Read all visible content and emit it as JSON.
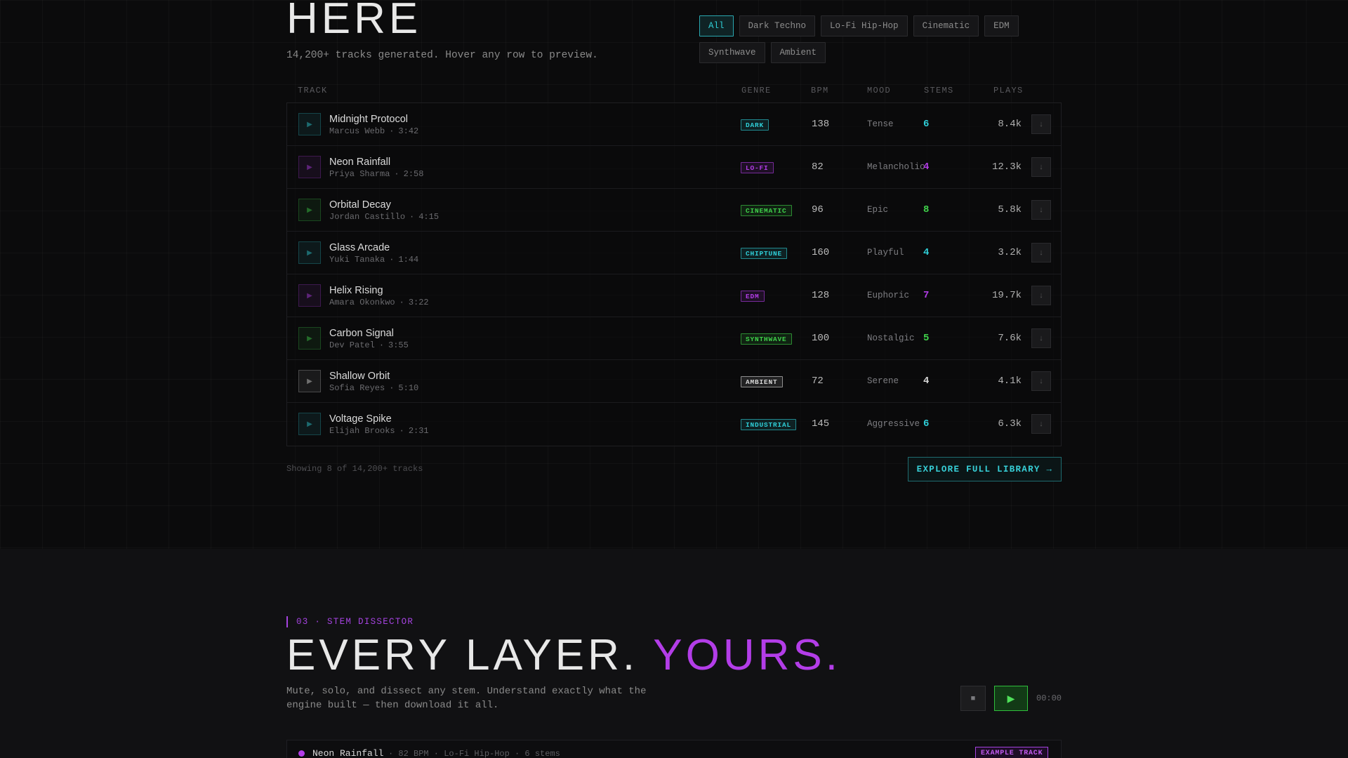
{
  "library": {
    "title": "HERE",
    "subtitle": "14,200+ tracks generated. Hover any row to preview.",
    "filters": [
      "All",
      "Dark Techno",
      "Lo-Fi Hip-Hop",
      "Cinematic",
      "EDM",
      "Synthwave",
      "Ambient"
    ],
    "active_filter": "All",
    "columns": {
      "track": "TRACK",
      "genre": "GENRE",
      "bpm": "BPM",
      "mood": "MOOD",
      "stems": "STEMS",
      "plays": "PLAYS"
    },
    "tracks": [
      {
        "name": "Midnight Protocol",
        "artist": "Marcus Webb",
        "duration": "3:42",
        "genre": "DARK",
        "bpm": "138",
        "mood": "Tense",
        "stems": "6",
        "plays": "8.4k",
        "color": "#2fcfd8"
      },
      {
        "name": "Neon Rainfall",
        "artist": "Priya Sharma",
        "duration": "2:58",
        "genre": "LO-FI",
        "bpm": "82",
        "mood": "Melancholic",
        "stems": "4",
        "plays": "12.3k",
        "color": "#b33de8"
      },
      {
        "name": "Orbital Decay",
        "artist": "Jordan Castillo",
        "duration": "4:15",
        "genre": "CINEMATIC",
        "bpm": "96",
        "mood": "Epic",
        "stems": "8",
        "plays": "5.8k",
        "color": "#3fd24a"
      },
      {
        "name": "Glass Arcade",
        "artist": "Yuki Tanaka",
        "duration": "1:44",
        "genre": "CHIPTUNE",
        "bpm": "160",
        "mood": "Playful",
        "stems": "4",
        "plays": "3.2k",
        "color": "#2fcfd8"
      },
      {
        "name": "Helix Rising",
        "artist": "Amara Okonkwo",
        "duration": "3:22",
        "genre": "EDM",
        "bpm": "128",
        "mood": "Euphoric",
        "stems": "7",
        "plays": "19.7k",
        "color": "#b33de8"
      },
      {
        "name": "Carbon Signal",
        "artist": "Dev Patel",
        "duration": "3:55",
        "genre": "SYNTHWAVE",
        "bpm": "100",
        "mood": "Nostalgic",
        "stems": "5",
        "plays": "7.6k",
        "color": "#3fd24a"
      },
      {
        "name": "Shallow Orbit",
        "artist": "Sofia Reyes",
        "duration": "5:10",
        "genre": "AMBIENT",
        "bpm": "72",
        "mood": "Serene",
        "stems": "4",
        "plays": "4.1k",
        "color": "#d8d8d8"
      },
      {
        "name": "Voltage Spike",
        "artist": "Elijah Brooks",
        "duration": "2:31",
        "genre": "INDUSTRIAL",
        "bpm": "145",
        "mood": "Aggressive",
        "stems": "6",
        "plays": "6.3k",
        "color": "#2fcfd8"
      }
    ],
    "showing": "Showing 8 of 14,200+ tracks",
    "explore_label": "EXPLORE FULL LIBRARY →"
  },
  "stems": {
    "kicker": "03 · STEM DISSECTOR",
    "title_main": "EVERY LAYER.",
    "title_accent": "YOURS.",
    "description": "Mute, solo, and dissect any stem. Understand exactly what the engine built — then download it all.",
    "time": "00:00",
    "current_track": {
      "name": "Neon Rainfall",
      "meta": "· 82 BPM · Lo-Fi Hip-Hop · 6 stems",
      "badge": "EXAMPLE TRACK"
    }
  },
  "icons": {
    "play": "play-icon",
    "stop": "stop-icon",
    "download": "download-icon"
  },
  "colors": {
    "cyan": "#2fcfd8",
    "purple": "#b33de8",
    "green": "#3fd24a",
    "background": "#0b0b0c"
  }
}
